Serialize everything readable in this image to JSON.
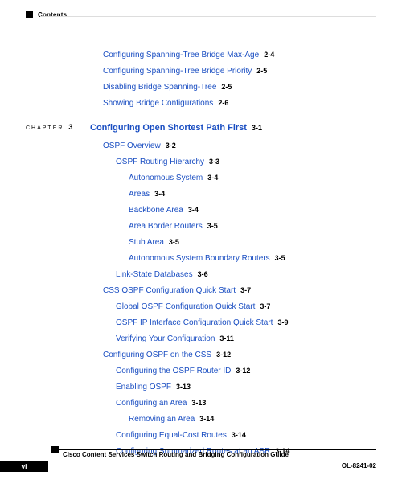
{
  "header": {
    "label": "Contents"
  },
  "pre_entries": [
    {
      "title": "Configuring Spanning-Tree Bridge Max-Age",
      "page": "2-4",
      "indent": 0
    },
    {
      "title": "Configuring Spanning-Tree Bridge Priority",
      "page": "2-5",
      "indent": 0
    },
    {
      "title": "Disabling Bridge Spanning-Tree",
      "page": "2-5",
      "indent": 0
    },
    {
      "title": "Showing Bridge Configurations",
      "page": "2-6",
      "indent": 0
    }
  ],
  "chapter": {
    "tag": "CHAPTER",
    "num": "3",
    "title": "Configuring Open Shortest Path First",
    "page": "3-1"
  },
  "entries": [
    {
      "title": "OSPF Overview",
      "page": "3-2",
      "indent": 2
    },
    {
      "title": "OSPF Routing Hierarchy",
      "page": "3-3",
      "indent": 3
    },
    {
      "title": "Autonomous System",
      "page": "3-4",
      "indent": 4
    },
    {
      "title": "Areas",
      "page": "3-4",
      "indent": 4
    },
    {
      "title": "Backbone Area",
      "page": "3-4",
      "indent": 4
    },
    {
      "title": "Area Border Routers",
      "page": "3-5",
      "indent": 4
    },
    {
      "title": "Stub Area",
      "page": "3-5",
      "indent": 4
    },
    {
      "title": "Autonomous System Boundary Routers",
      "page": "3-5",
      "indent": 4
    },
    {
      "title": "Link-State Databases",
      "page": "3-6",
      "indent": 3
    },
    {
      "title": "CSS OSPF Configuration Quick Start",
      "page": "3-7",
      "indent": 2
    },
    {
      "title": "Global OSPF Configuration Quick Start",
      "page": "3-7",
      "indent": 3
    },
    {
      "title": "OSPF IP Interface Configuration Quick Start",
      "page": "3-9",
      "indent": 3
    },
    {
      "title": "Verifying Your Configuration",
      "page": "3-11",
      "indent": 3
    },
    {
      "title": "Configuring OSPF on the CSS",
      "page": "3-12",
      "indent": 2
    },
    {
      "title": "Configuring the OSPF Router ID",
      "page": "3-12",
      "indent": 3
    },
    {
      "title": "Enabling OSPF",
      "page": "3-13",
      "indent": 3
    },
    {
      "title": "Configuring an Area",
      "page": "3-13",
      "indent": 3
    },
    {
      "title": "Removing an Area",
      "page": "3-14",
      "indent": 4
    },
    {
      "title": "Configuring Equal-Cost Routes",
      "page": "3-14",
      "indent": 3
    },
    {
      "title": "Configuring Summarized Routes at an ABR",
      "page": "3-14",
      "indent": 3
    }
  ],
  "footer": {
    "book_title": "Cisco Content Services Switch Routing and Bridging Configuration Guide",
    "page_num": "vi",
    "doc_id": "OL-8241-02"
  }
}
